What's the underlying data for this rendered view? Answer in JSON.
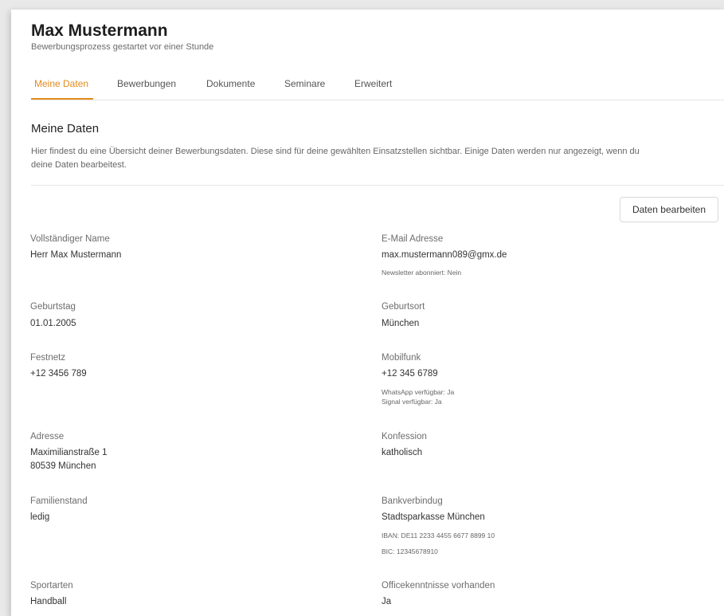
{
  "header": {
    "name": "Max Mustermann",
    "subtitle": "Bewerbungsprozess gestartet vor einer Stunde"
  },
  "tabs": [
    {
      "label": "Meine Daten",
      "active": true
    },
    {
      "label": "Bewerbungen",
      "active": false
    },
    {
      "label": "Dokumente",
      "active": false
    },
    {
      "label": "Seminare",
      "active": false
    },
    {
      "label": "Erweitert",
      "active": false
    }
  ],
  "section": {
    "title": "Meine Daten",
    "description": "Hier findest du eine Übersicht deiner Bewerbungsdaten. Diese sind für deine gewählten Einsatzstellen sichtbar. Einige Daten werden nur angezeigt, wenn du deine Daten bearbeitest.",
    "edit_button": "Daten bearbeiten"
  },
  "fields": {
    "full_name": {
      "label": "Vollständiger Name",
      "value": "Herr Max Mustermann"
    },
    "email": {
      "label": "E-Mail Adresse",
      "value": "max.mustermann089@gmx.de",
      "note": "Newsletter abonniert: Nein"
    },
    "birthday": {
      "label": "Geburtstag",
      "value": "01.01.2005"
    },
    "birthplace": {
      "label": "Geburtsort",
      "value": "München"
    },
    "landline": {
      "label": "Festnetz",
      "value": "+12 3456 789"
    },
    "mobile": {
      "label": "Mobilfunk",
      "value": "+12 345 6789",
      "note1": "WhatsApp verfügbar: Ja",
      "note2": "Signal verfügbar: Ja"
    },
    "address": {
      "label": "Adresse",
      "line1": "Maximilianstraße 1",
      "line2": "80539 München"
    },
    "confession": {
      "label": "Konfession",
      "value": "katholisch"
    },
    "marital": {
      "label": "Familienstand",
      "value": "ledig"
    },
    "bank": {
      "label": "Bankverbindug",
      "value": "Stadtsparkasse München",
      "iban": "IBAN: DE11 2233 4455 6677 8899 10",
      "bic": "BIC: 12345678910"
    },
    "sports": {
      "label": "Sportarten",
      "value": "Handball"
    },
    "office": {
      "label": "Officekenntnisse vorhanden",
      "value": "Ja"
    }
  }
}
